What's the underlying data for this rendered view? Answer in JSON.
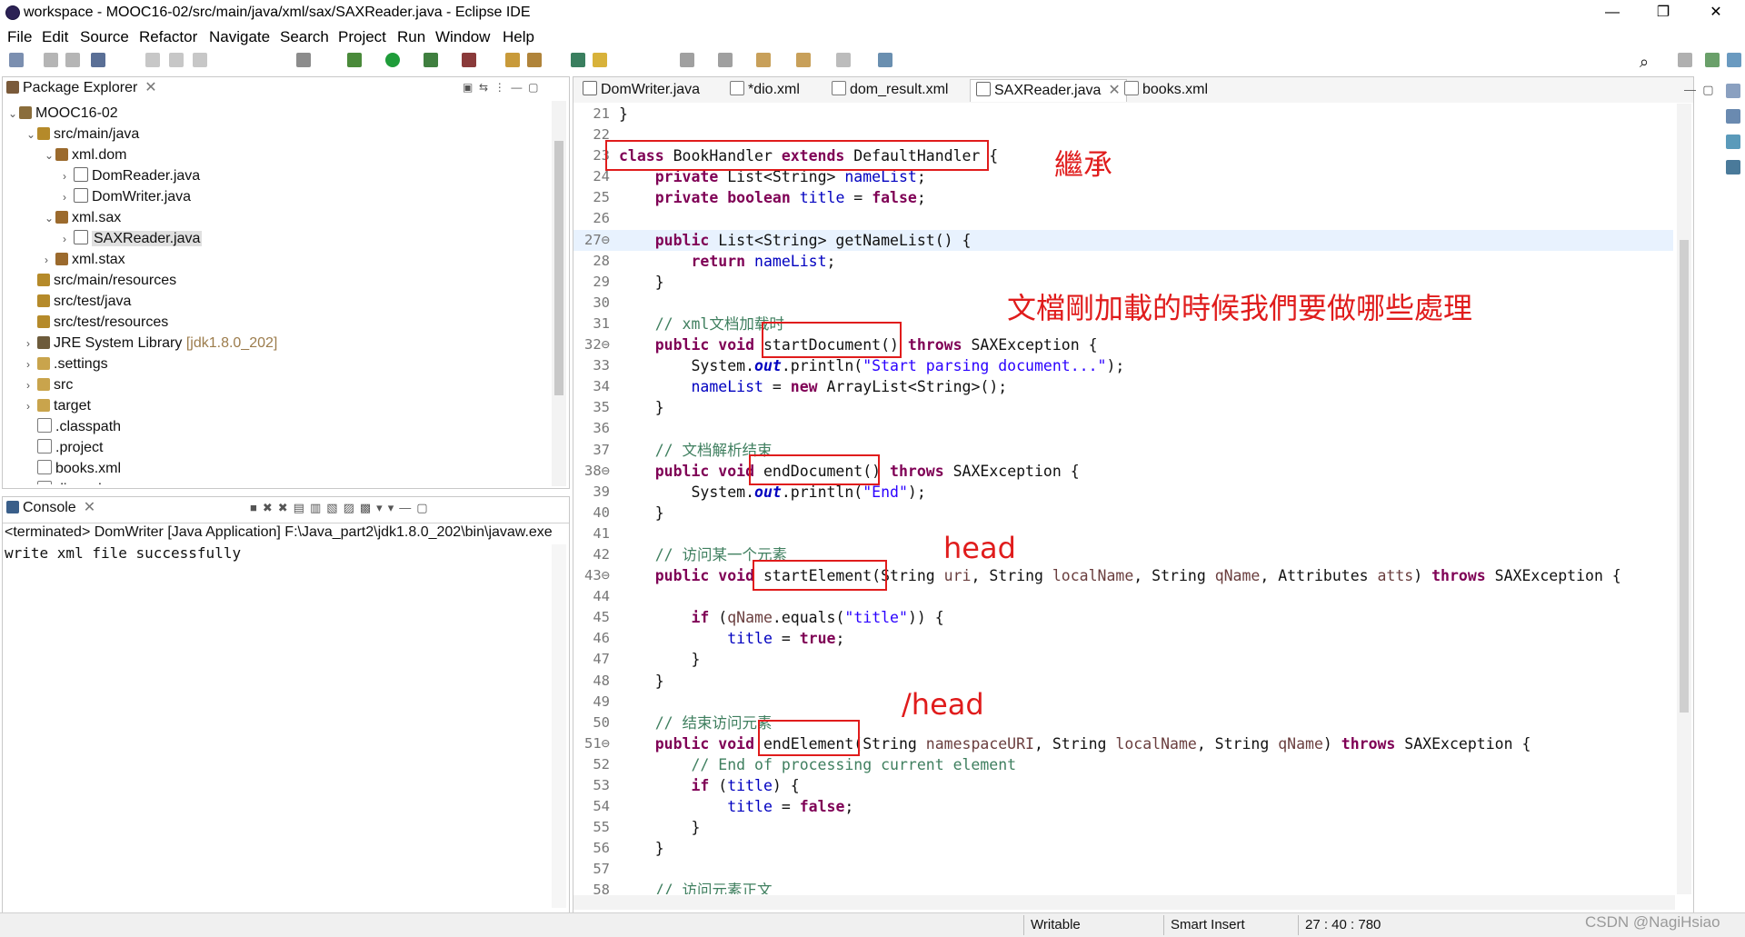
{
  "window": {
    "title": "workspace - MOOC16-02/src/main/java/xml/sax/SAXReader.java - Eclipse IDE"
  },
  "menu": [
    "File",
    "Edit",
    "Source",
    "Refactor",
    "Navigate",
    "Search",
    "Project",
    "Run",
    "Window",
    "Help"
  ],
  "package_explorer": {
    "title": "Package Explorer",
    "rows": [
      {
        "label": "MOOC16-02",
        "indent": 0,
        "twisty": "v",
        "icon": "proj"
      },
      {
        "label": "src/main/java",
        "indent": 1,
        "twisty": "v",
        "icon": "srcf"
      },
      {
        "label": "xml.dom",
        "indent": 2,
        "twisty": "v",
        "icon": "pkg"
      },
      {
        "label": "DomReader.java",
        "indent": 3,
        "twisty": ">",
        "icon": "java"
      },
      {
        "label": "DomWriter.java",
        "indent": 3,
        "twisty": ">",
        "icon": "java"
      },
      {
        "label": "xml.sax",
        "indent": 2,
        "twisty": "v",
        "icon": "pkg"
      },
      {
        "label": "SAXReader.java",
        "indent": 3,
        "twisty": ">",
        "icon": "java",
        "selected": true
      },
      {
        "label": "xml.stax",
        "indent": 2,
        "twisty": ">",
        "icon": "pkg"
      },
      {
        "label": "src/main/resources",
        "indent": 1,
        "twisty": "",
        "icon": "srcf"
      },
      {
        "label": "src/test/java",
        "indent": 1,
        "twisty": "",
        "icon": "srcf"
      },
      {
        "label": "src/test/resources",
        "indent": 1,
        "twisty": "",
        "icon": "srcf"
      },
      {
        "label": "JRE System Library",
        "suffix": "[jdk1.8.0_202]",
        "indent": 1,
        "twisty": ">",
        "icon": "lib"
      },
      {
        "label": ".settings",
        "indent": 1,
        "twisty": ">",
        "icon": "fold"
      },
      {
        "label": "src",
        "indent": 1,
        "twisty": ">",
        "icon": "fold"
      },
      {
        "label": "target",
        "indent": 1,
        "twisty": ">",
        "icon": "fold"
      },
      {
        "label": ".classpath",
        "indent": 1,
        "twisty": "",
        "icon": "xml"
      },
      {
        "label": ".project",
        "indent": 1,
        "twisty": "",
        "icon": "xml"
      },
      {
        "label": "books.xml",
        "indent": 1,
        "twisty": "",
        "icon": "xml"
      },
      {
        "label": "dio.xml",
        "indent": 1,
        "twisty": "",
        "icon": "xml"
      }
    ]
  },
  "console": {
    "title": "Console",
    "header": "<terminated> DomWriter [Java Application] F:\\Java_part2\\jdk1.8.0_202\\bin\\javaw.exe",
    "output": "write xml file successfully"
  },
  "editor": {
    "tabs": [
      {
        "label": "DomWriter.java",
        "active": false
      },
      {
        "label": "*dio.xml",
        "active": false
      },
      {
        "label": "dom_result.xml",
        "active": false
      },
      {
        "label": "SAXReader.java",
        "active": true
      },
      {
        "label": "books.xml",
        "active": false
      }
    ],
    "lines": [
      {
        "n": "21",
        "html": "}"
      },
      {
        "n": "22",
        "html": ""
      },
      {
        "n": "23",
        "html": "<span class='kw'>class</span> BookHandler <span class='kw'>extends</span> DefaultHandler {"
      },
      {
        "n": "24",
        "html": "    <span class='kw'>private</span> List&lt;String&gt; <span class='fld'>nameList</span>;"
      },
      {
        "n": "25",
        "html": "    <span class='kw'>private boolean</span> <span class='fld'>title</span> = <span class='kw'>false</span>;"
      },
      {
        "n": "26",
        "html": ""
      },
      {
        "n": "27⊖",
        "html": "    <span class='kw'>public</span> List&lt;String&gt; getNameList() {"
      },
      {
        "n": "28",
        "html": "        <span class='kw'>return</span> <span class='fld'>nameList</span>;"
      },
      {
        "n": "29",
        "html": "    }"
      },
      {
        "n": "30",
        "html": ""
      },
      {
        "n": "31",
        "html": "    <span class='cm'>// xml文档加载时</span>"
      },
      {
        "n": "32⊖",
        "html": "    <span class='kw'>public void</span> startDocument() <span class='kw'>throws</span> SAXException {"
      },
      {
        "n": "33",
        "html": "        System.<span class='st'>out</span>.println(<span class='str'>\"Start parsing document...\"</span>);"
      },
      {
        "n": "34",
        "html": "        <span class='fld'>nameList</span> = <span class='kw'>new</span> ArrayList&lt;String&gt;();"
      },
      {
        "n": "35",
        "html": "    }"
      },
      {
        "n": "36",
        "html": ""
      },
      {
        "n": "37",
        "html": "    <span class='cm'>// 文档解析结束</span>"
      },
      {
        "n": "38⊖",
        "html": "    <span class='kw'>public void</span> endDocument() <span class='kw'>throws</span> SAXException {"
      },
      {
        "n": "39",
        "html": "        System.<span class='st'>out</span>.println(<span class='str'>\"End\"</span>);"
      },
      {
        "n": "40",
        "html": "    }"
      },
      {
        "n": "41",
        "html": ""
      },
      {
        "n": "42",
        "html": "    <span class='cm'>// 访问某一个元素</span>"
      },
      {
        "n": "43⊖",
        "html": "    <span class='kw'>public void</span> startElement(String <span class='param'>uri</span>, String <span class='param'>localName</span>, String <span class='param'>qName</span>, Attributes <span class='param'>atts</span>) <span class='kw'>throws</span> SAXException {"
      },
      {
        "n": "44",
        "html": ""
      },
      {
        "n": "45",
        "html": "        <span class='kw'>if</span> (<span class='param'>qName</span>.equals(<span class='str'>\"title\"</span>)) {"
      },
      {
        "n": "46",
        "html": "            <span class='fld'>title</span> = <span class='kw'>true</span>;"
      },
      {
        "n": "47",
        "html": "        }"
      },
      {
        "n": "48",
        "html": "    }"
      },
      {
        "n": "49",
        "html": ""
      },
      {
        "n": "50",
        "html": "    <span class='cm'>// 结束访问元素</span>"
      },
      {
        "n": "51⊖",
        "html": "    <span class='kw'>public void</span> endElement(String <span class='param'>namespaceURI</span>, String <span class='param'>localName</span>, String <span class='param'>qName</span>) <span class='kw'>throws</span> SAXException {"
      },
      {
        "n": "52",
        "html": "        <span class='cm'>// End of processing current element</span>"
      },
      {
        "n": "53",
        "html": "        <span class='kw'>if</span> (<span class='fld'>title</span>) {"
      },
      {
        "n": "54",
        "html": "            <span class='fld'>title</span> = <span class='kw'>false</span>;"
      },
      {
        "n": "55",
        "html": "        }"
      },
      {
        "n": "56",
        "html": "    }"
      },
      {
        "n": "57",
        "html": ""
      },
      {
        "n": "58",
        "html": "    <span class='cm'>// 访问元素正文</span>"
      }
    ]
  },
  "annotations": {
    "inherit": "繼承",
    "doc_load": "文檔剛加載的時候我們要做哪些處理",
    "head": "head",
    "end_head": "/head"
  },
  "status": {
    "writable": "Writable",
    "insert": "Smart Insert",
    "position": "27 : 40 : 780"
  },
  "watermark": "CSDN @NagiHsiao"
}
